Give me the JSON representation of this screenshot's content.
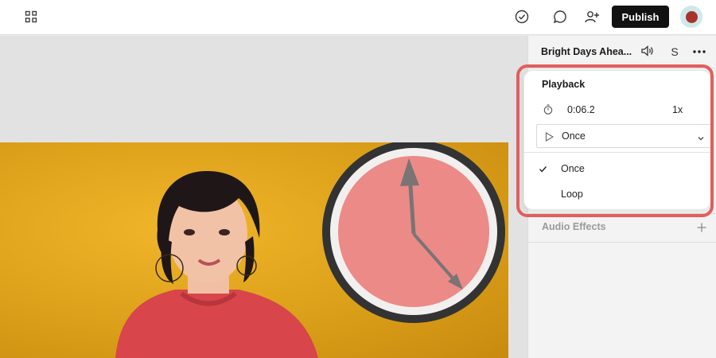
{
  "toolbar": {
    "publish_label": "Publish",
    "icons": [
      "grid-icon",
      "check-circle-icon",
      "chat-bubble-icon",
      "add-user-icon"
    ]
  },
  "track": {
    "title": "Bright Days Ahea...",
    "s_label": "S"
  },
  "playback": {
    "title": "Playback",
    "duration": "0:06.2",
    "speed": "1x",
    "mode_selected": "Once",
    "options": [
      {
        "label": "Once",
        "checked": true
      },
      {
        "label": "Loop",
        "checked": false
      }
    ]
  },
  "audio_effects": {
    "label": "Audio Effects"
  },
  "colors": {
    "publish_bg": "#111111",
    "highlight": "#e35d5d",
    "clock_face": "#ec8a87",
    "clock_rim": "#333333",
    "background_yellow": "#dba019",
    "sweater_red": "#d8454b"
  }
}
